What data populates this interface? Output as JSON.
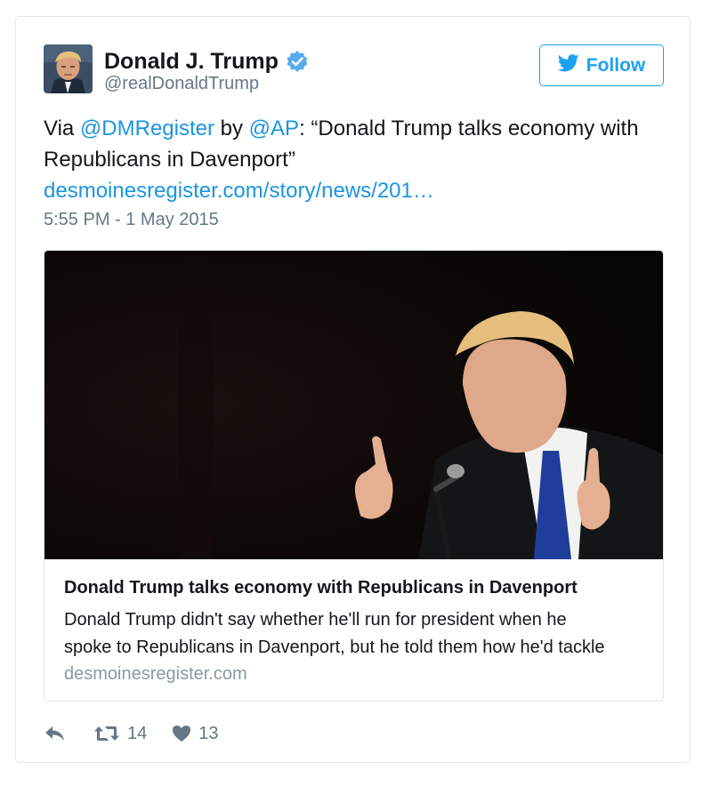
{
  "author": {
    "name": "Donald J. Trump",
    "handle": "@realDonaldTrump",
    "verified": true
  },
  "follow_button": {
    "label": "Follow",
    "icon": "twitter-bird-icon"
  },
  "tweet": {
    "prefix": "Via ",
    "mention1": "@DMRegister",
    "by": " by ",
    "mention2": "@AP",
    "quote": ": “Donald Trump talks economy with Republicans in Davenport”",
    "link": "desmoinesregister.com/story/news/201…",
    "timestamp": "5:55 PM - 1 May 2015"
  },
  "card": {
    "title": "Donald Trump talks economy with Republicans in Davenport",
    "description_line1": "Donald Trump didn't say whether he'll run for president when he",
    "description_line2": "spoke to Republicans in Davenport, but he told them how he'd tackle",
    "domain": "desmoinesregister.com"
  },
  "actions": {
    "retweets": "14",
    "likes": "13"
  },
  "colors": {
    "link": "#1b95e0",
    "accent": "#1da1f2",
    "secondary_text": "#657786",
    "border": "#e1e8ed"
  }
}
